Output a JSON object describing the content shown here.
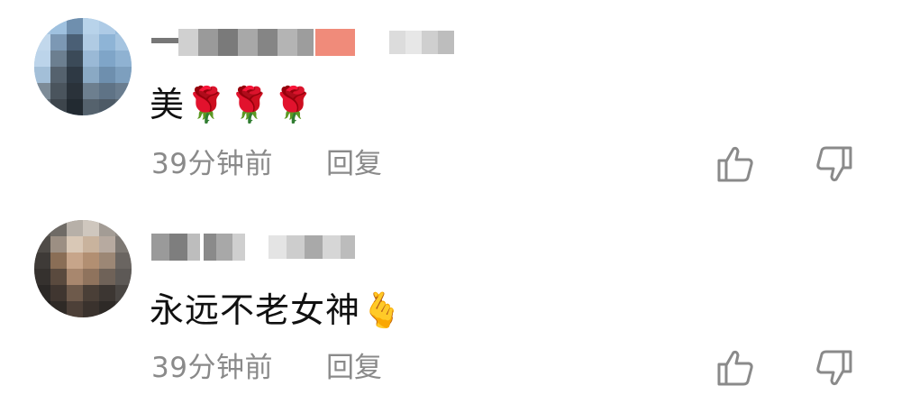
{
  "comments": [
    {
      "body": "美🌹🌹🌹",
      "time": "39分钟前",
      "reply_label": "回复",
      "like_icon": "thumbs-up-icon",
      "dislike_icon": "thumbs-down-icon"
    },
    {
      "body": "永远不老女神🫰",
      "time": "39分钟前",
      "reply_label": "回复",
      "like_icon": "thumbs-up-icon",
      "dislike_icon": "thumbs-down-icon"
    }
  ],
  "colors": {
    "text": "#111111",
    "meta": "#8a8a8a",
    "icon": "#8a8a8a",
    "background": "#ffffff",
    "name_pixel_accent": "#f08b7a"
  }
}
